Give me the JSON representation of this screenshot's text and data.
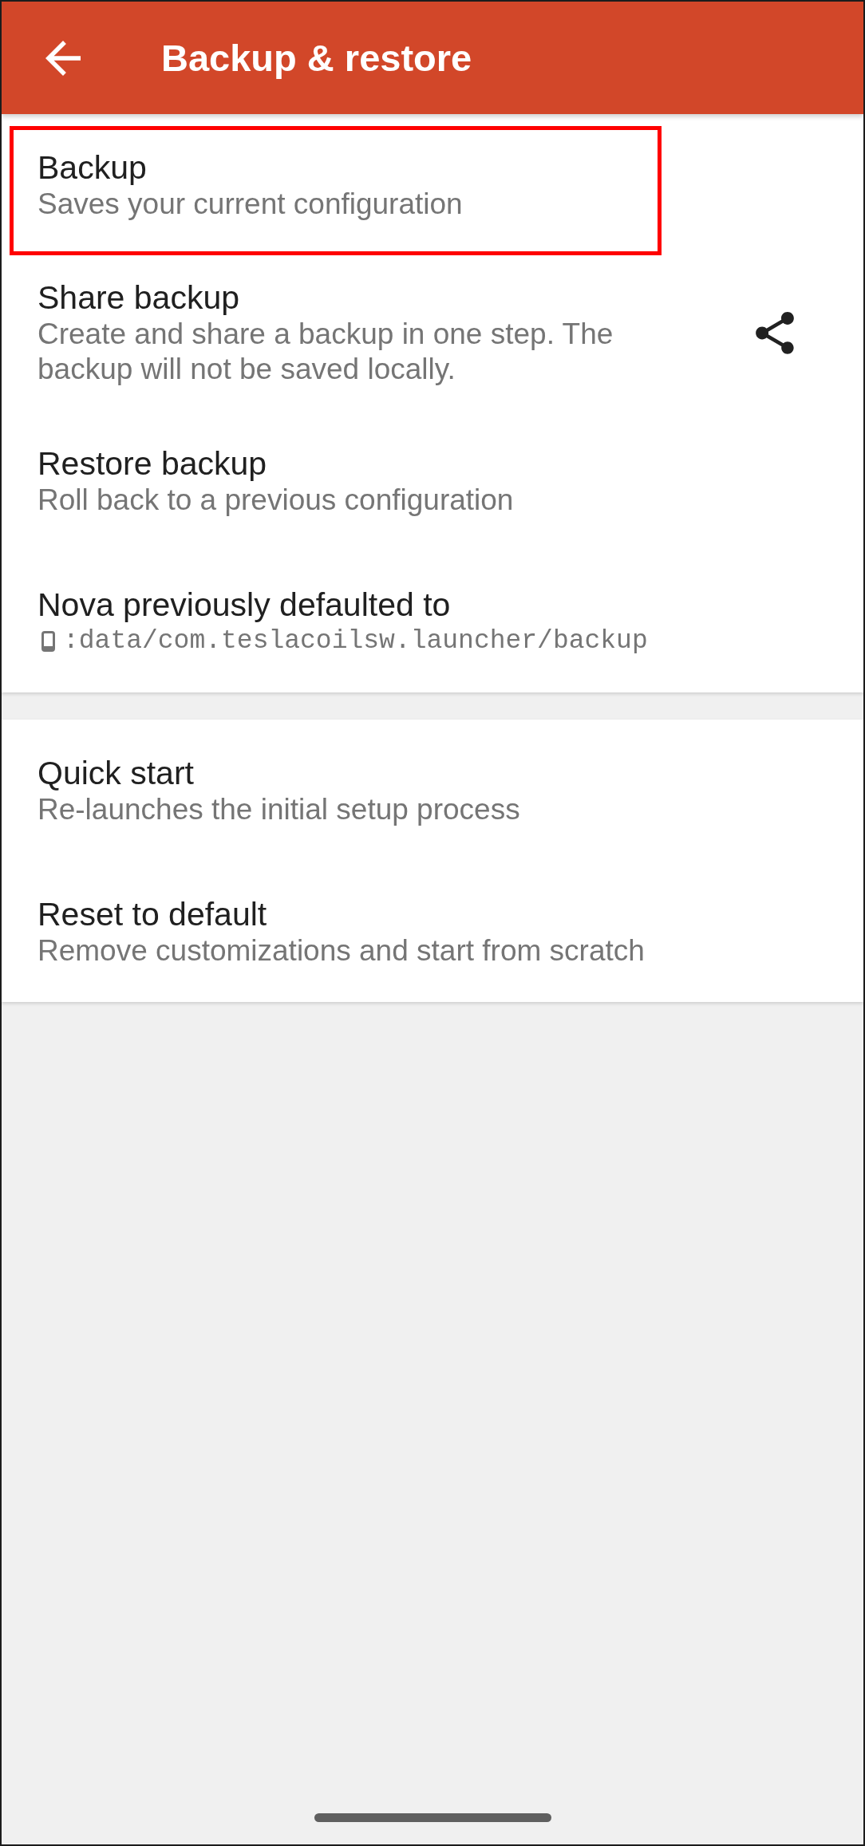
{
  "app_bar": {
    "title": "Backup & restore"
  },
  "sections": [
    {
      "items": [
        {
          "kind": "text",
          "title": "Backup",
          "description": "Saves your current configuration",
          "highlighted": true
        },
        {
          "kind": "share",
          "title": "Share backup",
          "description": "Create and share a backup in one step. The backup will not be saved locally.",
          "highlighted": false
        },
        {
          "kind": "text",
          "title": "Restore backup",
          "description": "Roll back to a previous configuration",
          "highlighted": false
        },
        {
          "kind": "path",
          "title": "Nova previously defaulted to",
          "description": ":data/com.teslacoilsw.launcher/backup",
          "highlighted": false
        }
      ]
    },
    {
      "items": [
        {
          "kind": "text",
          "title": "Quick start",
          "description": "Re-launches the initial setup process",
          "highlighted": false
        },
        {
          "kind": "text",
          "title": "Reset to default",
          "description": "Remove customizations and start from scratch",
          "highlighted": false
        }
      ]
    }
  ]
}
